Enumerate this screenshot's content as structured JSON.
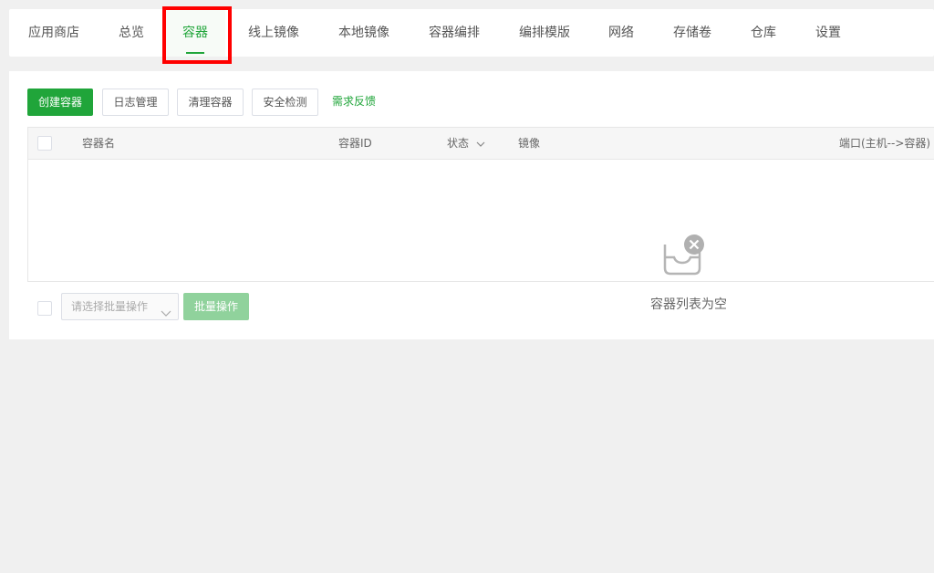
{
  "nav": {
    "tabs": [
      {
        "label": "应用商店"
      },
      {
        "label": "总览"
      },
      {
        "label": "容器"
      },
      {
        "label": "线上镜像"
      },
      {
        "label": "本地镜像"
      },
      {
        "label": "容器编排"
      },
      {
        "label": "编排模版"
      },
      {
        "label": "网络"
      },
      {
        "label": "存储卷"
      },
      {
        "label": "仓库"
      },
      {
        "label": "设置"
      }
    ],
    "active": "容器"
  },
  "toolbar": {
    "create_label": "创建容器",
    "logs_label": "日志管理",
    "clean_label": "清理容器",
    "security_label": "安全检测",
    "feedback_label": "需求反馈"
  },
  "table": {
    "columns": {
      "name": "容器名",
      "id": "容器ID",
      "status": "状态",
      "image": "镜像",
      "ports": "端口(主机-->容器)"
    },
    "empty_text": "容器列表为空"
  },
  "batch": {
    "select_placeholder": "请选择批量操作",
    "button_label": "批量操作"
  },
  "colors": {
    "accent": "#20a53a",
    "highlight": "#ff0000"
  }
}
